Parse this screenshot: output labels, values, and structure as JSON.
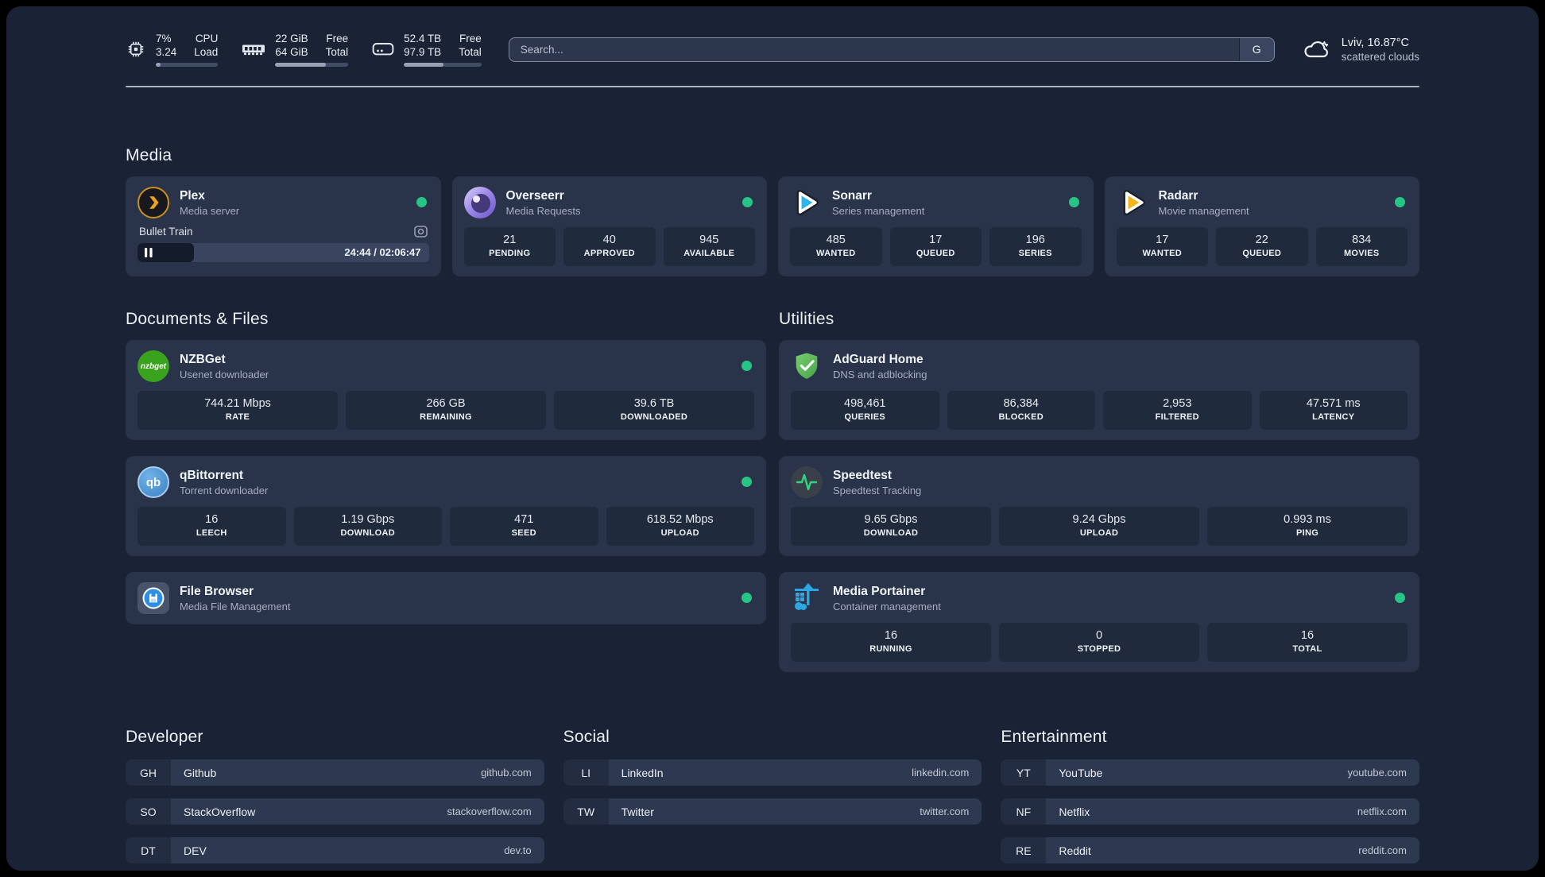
{
  "header": {
    "stats": [
      {
        "icon": "cpu-icon",
        "v1": "7%",
        "v2": "3.24",
        "l1": "CPU",
        "l2": "Load",
        "progress": 8
      },
      {
        "icon": "ram-icon",
        "v1": "22 GiB",
        "v2": "64 GiB",
        "l1": "Free",
        "l2": "Total",
        "progress": 69
      },
      {
        "icon": "disk-icon",
        "v1": "52.4 TB",
        "v2": "97.9 TB",
        "l1": "Free",
        "l2": "Total",
        "progress": 51
      }
    ],
    "search": {
      "placeholder": "Search...",
      "engine_label": "G"
    },
    "weather": {
      "icon": "cloud-icon",
      "location": "Lviv, 16.87°C",
      "condition": "scattered clouds"
    }
  },
  "icon_text": {
    "nzbget_badge": "nzbget",
    "qbittorrent_badge": "qb"
  },
  "sections": {
    "media": {
      "title": "Media",
      "plex": {
        "title": "Plex",
        "subtitle": "Media server",
        "online": true,
        "now_playing": {
          "title": "Bullet Train",
          "time": "24:44 / 02:06:47",
          "progress_pct": 19.5
        }
      },
      "overseerr": {
        "title": "Overseerr",
        "subtitle": "Media Requests",
        "online": true,
        "stats": [
          {
            "value": "21",
            "label": "PENDING"
          },
          {
            "value": "40",
            "label": "APPROVED"
          },
          {
            "value": "945",
            "label": "AVAILABLE"
          }
        ]
      },
      "sonarr": {
        "title": "Sonarr",
        "subtitle": "Series management",
        "online": true,
        "stats": [
          {
            "value": "485",
            "label": "WANTED"
          },
          {
            "value": "17",
            "label": "QUEUED"
          },
          {
            "value": "196",
            "label": "SERIES"
          }
        ]
      },
      "radarr": {
        "title": "Radarr",
        "subtitle": "Movie management",
        "online": true,
        "stats": [
          {
            "value": "17",
            "label": "WANTED"
          },
          {
            "value": "22",
            "label": "QUEUED"
          },
          {
            "value": "834",
            "label": "MOVIES"
          }
        ]
      }
    },
    "files": {
      "title": "Documents & Files",
      "nzbget": {
        "title": "NZBGet",
        "subtitle": "Usenet downloader",
        "online": true,
        "stats": [
          {
            "value": "744.21 Mbps",
            "label": "RATE"
          },
          {
            "value": "266 GB",
            "label": "REMAINING"
          },
          {
            "value": "39.6 TB",
            "label": "DOWNLOADED"
          }
        ]
      },
      "qbittorrent": {
        "title": "qBittorrent",
        "subtitle": "Torrent downloader",
        "online": true,
        "stats": [
          {
            "value": "16",
            "label": "LEECH"
          },
          {
            "value": "1.19 Gbps",
            "label": "DOWNLOAD"
          },
          {
            "value": "471",
            "label": "SEED"
          },
          {
            "value": "618.52 Mbps",
            "label": "UPLOAD"
          }
        ]
      },
      "filebrowser": {
        "title": "File Browser",
        "subtitle": "Media File Management",
        "online": true
      }
    },
    "utilities": {
      "title": "Utilities",
      "adguard": {
        "title": "AdGuard Home",
        "subtitle": "DNS and adblocking",
        "stats": [
          {
            "value": "498,461",
            "label": "QUERIES"
          },
          {
            "value": "86,384",
            "label": "BLOCKED"
          },
          {
            "value": "2,953",
            "label": "FILTERED"
          },
          {
            "value": "47.571 ms",
            "label": "LATENCY"
          }
        ]
      },
      "speedtest": {
        "title": "Speedtest",
        "subtitle": "Speedtest Tracking",
        "stats": [
          {
            "value": "9.65 Gbps",
            "label": "DOWNLOAD"
          },
          {
            "value": "9.24 Gbps",
            "label": "UPLOAD"
          },
          {
            "value": "0.993 ms",
            "label": "PING"
          }
        ]
      },
      "portainer": {
        "title": "Media Portainer",
        "subtitle": "Container management",
        "online": true,
        "stats": [
          {
            "value": "16",
            "label": "RUNNING"
          },
          {
            "value": "0",
            "label": "STOPPED"
          },
          {
            "value": "16",
            "label": "TOTAL"
          }
        ]
      }
    },
    "bookmarks": [
      {
        "title": "Developer",
        "links": [
          {
            "abbr": "GH",
            "name": "Github",
            "url": "github.com"
          },
          {
            "abbr": "SO",
            "name": "StackOverflow",
            "url": "stackoverflow.com"
          },
          {
            "abbr": "DT",
            "name": "DEV",
            "url": "dev.to"
          }
        ]
      },
      {
        "title": "Social",
        "links": [
          {
            "abbr": "LI",
            "name": "LinkedIn",
            "url": "linkedin.com"
          },
          {
            "abbr": "TW",
            "name": "Twitter",
            "url": "twitter.com"
          }
        ]
      },
      {
        "title": "Entertainment",
        "links": [
          {
            "abbr": "YT",
            "name": "YouTube",
            "url": "youtube.com"
          },
          {
            "abbr": "NF",
            "name": "Netflix",
            "url": "netflix.com"
          },
          {
            "abbr": "RE",
            "name": "Reddit",
            "url": "reddit.com"
          }
        ]
      }
    ]
  },
  "theme": {
    "status_online": "#26c585",
    "background": "#1a2335",
    "card": "#29344a",
    "tile": "#1f2a3c"
  }
}
